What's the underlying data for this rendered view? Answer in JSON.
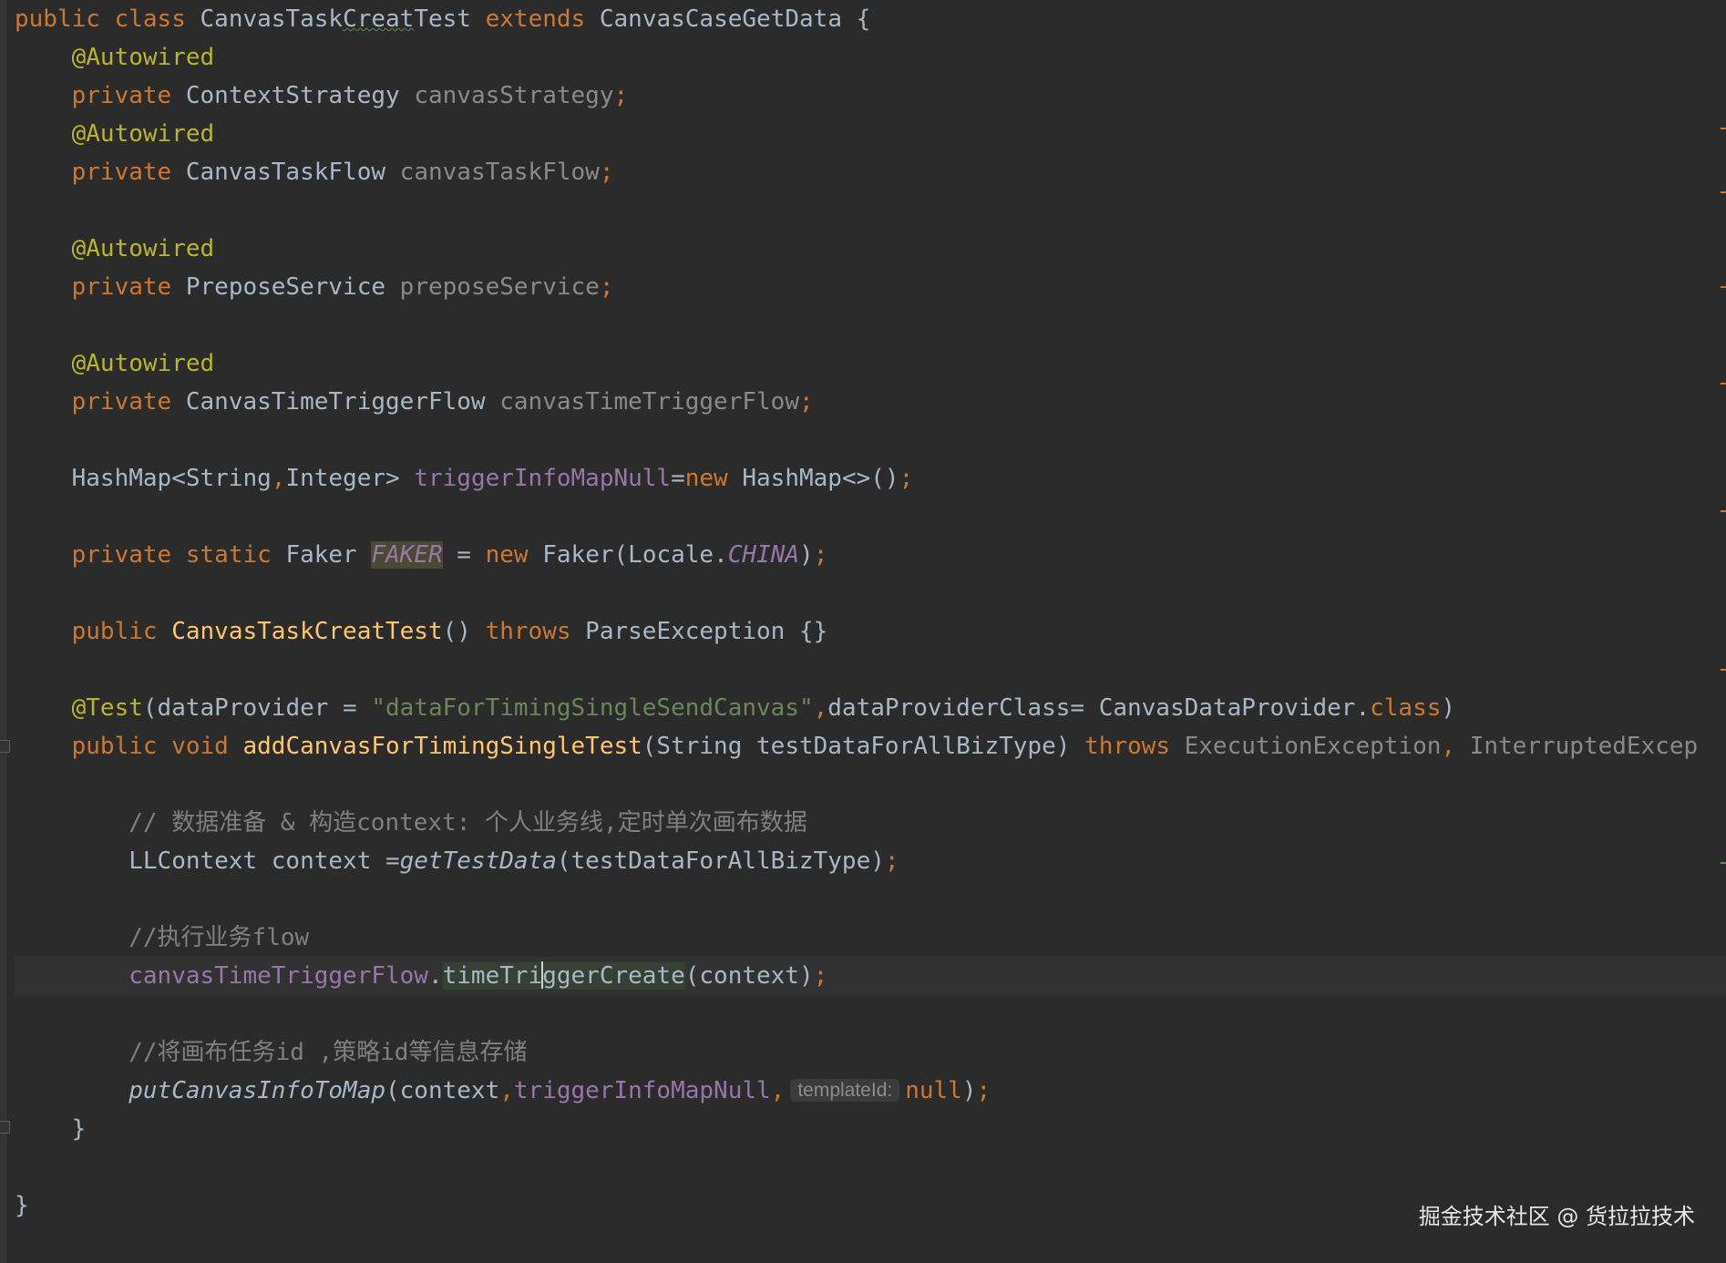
{
  "editor": {
    "line1": {
      "kw1": "public",
      "kw2": "class",
      "cls_a": "CanvasTask",
      "cls_b": "Creat",
      "cls_c": "Test",
      "kw3": "extends",
      "parent": "CanvasCaseGetData",
      "brace": " {"
    },
    "annotation_autowired": "@Autowired",
    "kw_private": "private",
    "kw_public": "public",
    "kw_static": "static",
    "kw_new": "new",
    "kw_throws": "throws",
    "kw_void": "void",
    "kw_class": "class",
    "kw_null": "null",
    "line3": {
      "type": "ContextStrategy",
      "field": "canvasStrategy",
      "semi": ";"
    },
    "line5": {
      "type": "CanvasTaskFlow",
      "field": "canvasTaskFlow",
      "semi": ";"
    },
    "line8": {
      "type": "PreposeService",
      "field": "preposeService",
      "semi": ";"
    },
    "line11": {
      "type": "CanvasTimeTriggerFlow",
      "field": "canvasTimeTriggerFlow",
      "semi": ";"
    },
    "line13": {
      "decl": "HashMap<String",
      "comma": ",",
      "decl2": "Integer> ",
      "field": "triggerInfoMapNull",
      "eq": "=",
      "ctor": " HashMap<>()",
      "semi": ";"
    },
    "line15": {
      "type": "Faker",
      "field": "FAKER",
      "eq": " = ",
      "ctor": "Faker(Locale.",
      "const": "CHINA",
      "close": ")",
      "semi": ";"
    },
    "line17": {
      "name": "CanvasTaskCreatTest",
      "parens": "() ",
      "exc": "ParseException",
      "body": " {}"
    },
    "line19": {
      "ann": "@Test",
      "open": "(dataProvider = ",
      "str": "\"dataForTimingSingleSendCanvas\"",
      "comma": ",",
      "rest": "dataProviderClass= CanvasDataProvider.",
      "close": ")"
    },
    "line20": {
      "name": "addCanvasForTimingSingleTest",
      "params": "(String testDataForAllBizType) ",
      "exc1": "ExecutionException",
      "comma": ", ",
      "exc2": "InterruptedExcep"
    },
    "line22": {
      "comment": "// 数据准备 & 构造context: 个人业务线,定时单次画布数据"
    },
    "line23": {
      "decl": "LLContext context =",
      "call": "getTestData",
      "args": "(testDataForAllBizType)",
      "semi": ";"
    },
    "line25": {
      "comment": "//执行业务flow"
    },
    "line26": {
      "field": "canvasTimeTriggerFlow",
      "dot": ".",
      "method_a": "timeTri",
      "method_b": "ggerCreate",
      "args": "(context)",
      "semi": ";"
    },
    "line28": {
      "comment": "//将画布任务id ,策略id等信息存储"
    },
    "line29": {
      "call": "putCanvasInfoToMap",
      "open": "(context",
      "comma": ",",
      "field": "triggerInfoMapNull",
      "comma2": ",",
      "hint": "templateId:",
      "close": ")",
      "semi": ";"
    },
    "line30": {
      "brace": "}"
    },
    "line32": {
      "brace": "}"
    }
  },
  "watermark": "掘金技术社区 @ 货拉拉技术",
  "colors": {
    "background": "#2b2b2b",
    "keyword": "#cc7832",
    "annotation": "#bbb529",
    "field": "#9876aa",
    "method": "#ffc66d",
    "string": "#6a8759",
    "comment": "#808080",
    "text": "#a9b7c6"
  }
}
